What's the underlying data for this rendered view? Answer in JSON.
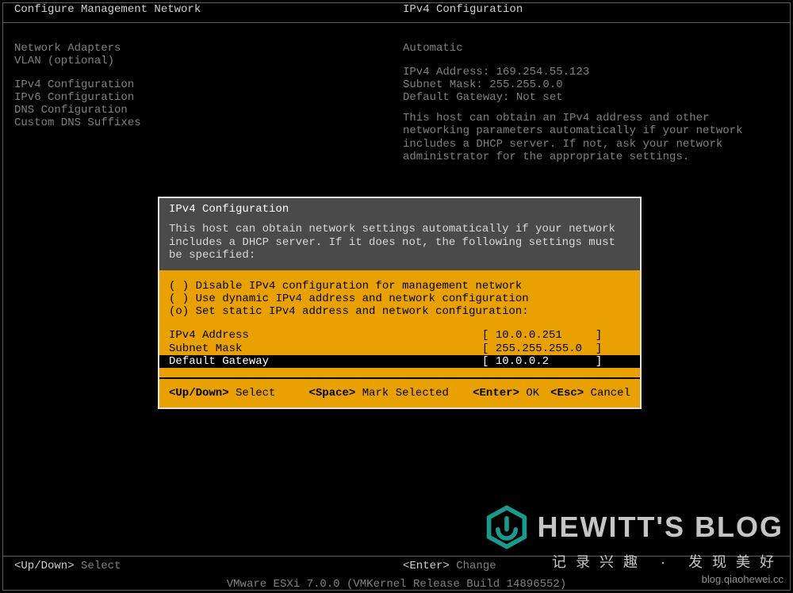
{
  "header": {
    "left": "Configure Management Network",
    "right": "IPv4 Configuration"
  },
  "left_menu": {
    "group1": [
      "Network Adapters",
      "VLAN (optional)"
    ],
    "group2": [
      "IPv4 Configuration",
      "IPv6 Configuration",
      "DNS Configuration",
      "Custom DNS Suffixes"
    ]
  },
  "right_panel": {
    "mode": "Automatic",
    "lines": [
      "IPv4 Address: 169.254.55.123",
      "Subnet Mask: 255.255.0.0",
      "Default Gateway: Not set"
    ],
    "paragraph": "This host can obtain an IPv4 address and other networking parameters automatically if your network includes a DHCP server. If not, ask your network administrator for the appropriate settings."
  },
  "dialog": {
    "title": "IPv4 Configuration",
    "description": "This host can obtain network settings automatically if your network includes a DHCP server. If it does not, the following settings must be specified:",
    "options": [
      {
        "marker": "( )",
        "label": "Disable IPv4 configuration for management network"
      },
      {
        "marker": "( )",
        "label": "Use dynamic IPv4 address and network configuration"
      },
      {
        "marker": "(o)",
        "label": "Set static IPv4 address and network configuration:"
      }
    ],
    "fields": [
      {
        "label": "IPv4 Address",
        "value": "10.0.0.251",
        "selected": false
      },
      {
        "label": "Subnet Mask",
        "value": "255.255.255.0",
        "selected": false
      },
      {
        "label": "Default Gateway",
        "value": "10.0.0.2",
        "selected": true
      }
    ],
    "footer": {
      "updown_key": "<Up/Down>",
      "updown_label": "Select",
      "space_key": "<Space>",
      "space_label": "Mark Selected",
      "enter_key": "<Enter>",
      "enter_label": "OK",
      "esc_key": "<Esc>",
      "esc_label": "Cancel"
    }
  },
  "bottom": {
    "left_key": "<Up/Down>",
    "left_label": "Select",
    "right_key": "<Enter>",
    "right_label": "Change"
  },
  "version": "VMware ESXi 7.0.0 (VMKernel Release Build 14896552)",
  "watermark": {
    "title": "HEWITT'S BLOG",
    "sub": "记录兴趣 · 发现美好",
    "url": "blog.qiaohewei.cc"
  }
}
